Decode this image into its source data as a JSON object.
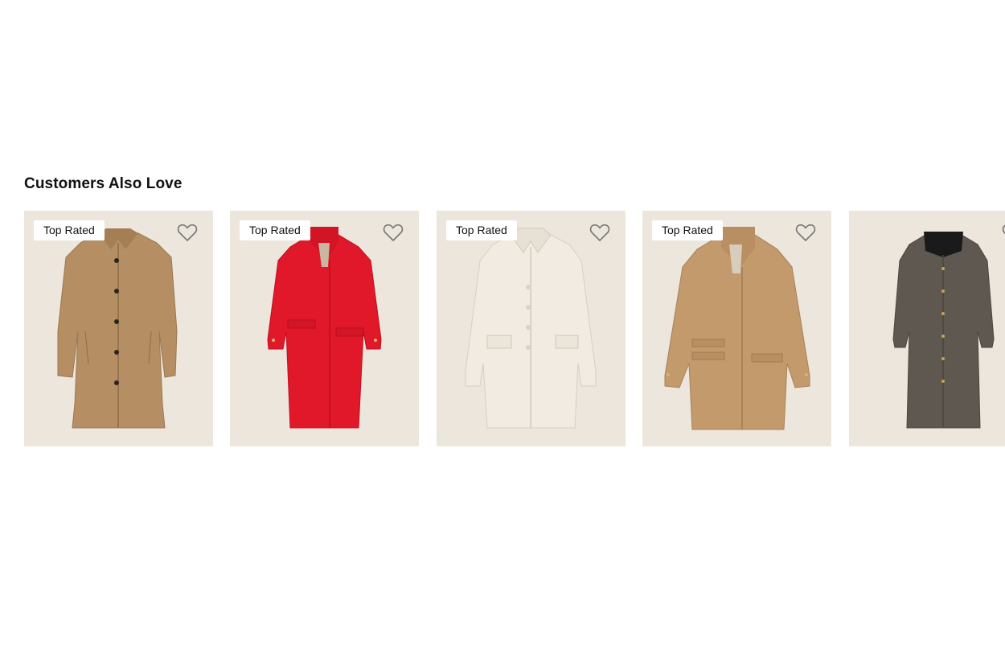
{
  "section": {
    "title": "Customers Also Love"
  },
  "products": [
    {
      "badge": "Top Rated",
      "favorite_icon": "heart-outline-icon",
      "coat_color": "#b58e63"
    },
    {
      "badge": "Top Rated",
      "favorite_icon": "heart-outline-icon",
      "coat_color": "#e0182a"
    },
    {
      "badge": "Top Rated",
      "favorite_icon": "heart-outline-icon",
      "coat_color": "#ede6da"
    },
    {
      "badge": "Top Rated",
      "favorite_icon": "heart-outline-icon",
      "coat_color": "#c39a6c"
    },
    {
      "badge": "",
      "favorite_icon": "heart-outline-icon",
      "coat_color": "#5f5850"
    }
  ],
  "colors": {
    "card_background": "#ece6dc",
    "badge_background": "#ffffff",
    "heart_stroke": "#777777"
  }
}
